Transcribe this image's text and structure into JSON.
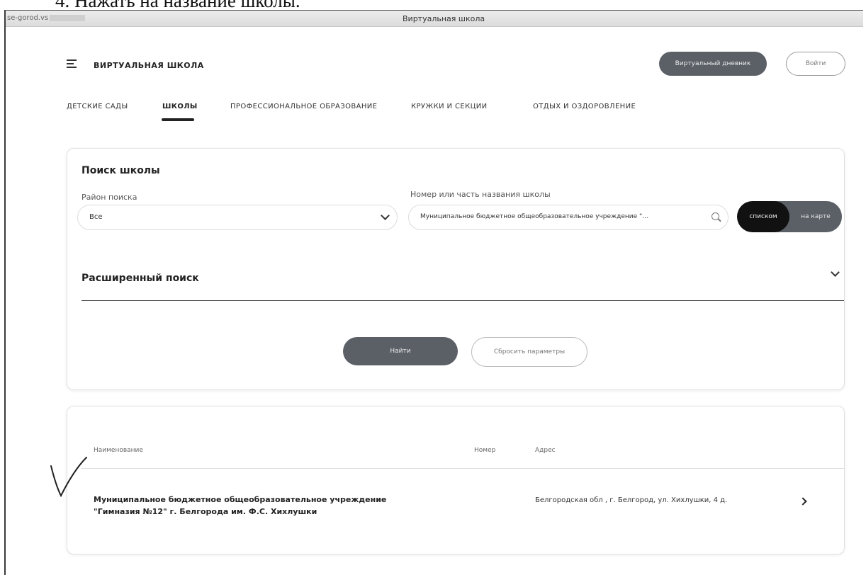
{
  "document": {
    "caption": "4. Нажать на название школы."
  },
  "window": {
    "title": "Виртуальная школа",
    "url_partial": "se-gorod.vs"
  },
  "header": {
    "brand": "ВИРТУАЛЬНАЯ ШКОЛА",
    "diary_button": "Виртуальный дневник",
    "login_button": "Войти"
  },
  "tabs": [
    {
      "label": "ДЕТСКИЕ САДЫ",
      "active": false
    },
    {
      "label": "ШКОЛЫ",
      "active": true
    },
    {
      "label": "ПРОФЕССИОНАЛЬНОЕ ОБРАЗОВАНИЕ",
      "active": false
    },
    {
      "label": "КРУЖКИ И СЕКЦИИ",
      "active": false
    },
    {
      "label": "ОТДЫХ И ОЗДОРОВЛЕНИЕ",
      "active": false
    }
  ],
  "search": {
    "title": "Поиск школы",
    "district_label": "Район поиска",
    "district_value": "Все",
    "query_label": "Номер или часть названия школы",
    "query_value": "Муниципальное бюджетное общеобразовательное учреждение \"…",
    "view_list": "списком",
    "view_map": "на карте",
    "advanced_title": "Расширенный поиск",
    "find_button": "Найти",
    "reset_button": "Сбросить параметры"
  },
  "results": {
    "columns": [
      "Наименование",
      "Номер",
      "Адрес"
    ],
    "rows": [
      {
        "name_line1": "Муниципальное бюджетное общеобразовательное учреждение",
        "name_line2": "\"Гимназия №12\" г. Белгорода им. Ф.С. Хихлушки",
        "number": "",
        "address": "Белгородская обл , г. Белгород, ул. Хихлушки, 4 д."
      }
    ]
  },
  "colors": {
    "dark_button": "#5b5f66",
    "active_toggle": "#111111",
    "text": "#222222"
  },
  "annotation": {
    "mark": "handwritten-checkmark"
  }
}
